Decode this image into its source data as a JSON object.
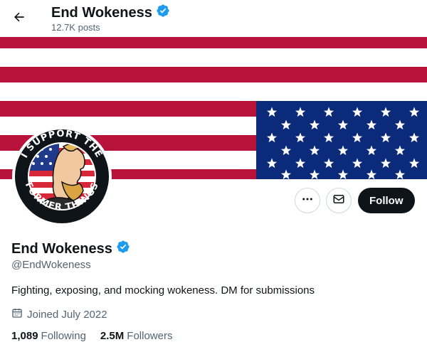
{
  "header": {
    "name": "End Wokeness",
    "posts": "12.7K posts"
  },
  "avatar": {
    "ring_text_top": "I SUPPORT THE",
    "ring_text_bottom": "FORMER THINGS"
  },
  "actions": {
    "follow_label": "Follow"
  },
  "profile": {
    "name": "End Wokeness",
    "handle": "@EndWokeness",
    "bio": "Fighting, exposing, and mocking wokeness. DM for submissions",
    "joined": "Joined July 2022",
    "following_count": "1,089",
    "following_label": "Following",
    "followers_count": "2.5M",
    "followers_label": "Followers"
  },
  "colors": {
    "verified": "#1d9bf0",
    "flag_red": "#b8133a",
    "flag_blue": "#0c2a7a",
    "text": "#0f1419",
    "muted": "#536471"
  },
  "icons": {
    "back": "arrow-left-icon",
    "verified": "verified-badge-icon",
    "more": "more-horizontal-icon",
    "message": "envelope-icon",
    "calendar": "calendar-icon"
  }
}
